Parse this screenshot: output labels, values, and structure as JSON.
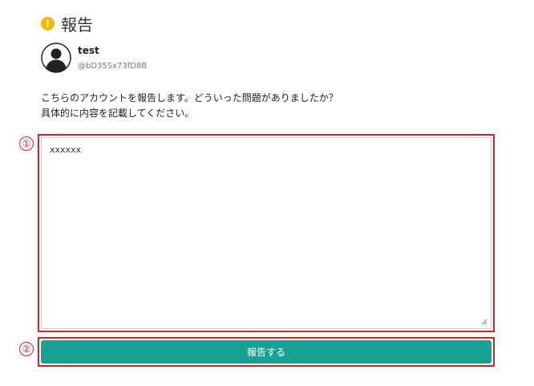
{
  "header": {
    "icon": "warning-icon",
    "icon_glyph": "!",
    "title": "報告"
  },
  "user": {
    "avatar_icon": "user-avatar-icon",
    "name": "test",
    "handle": "@bD35Sx73fD8B"
  },
  "description": {
    "line1": "こちらのアカウントを報告します。どういった問題がありましたか？",
    "line2": "具体的に内容を記載してください。"
  },
  "markers": {
    "one": "①",
    "two": "②"
  },
  "form": {
    "textarea_value": "xxxxxx",
    "submit_label": "報告する"
  },
  "colors": {
    "accent": "#18a294",
    "warning": "#f5b800",
    "highlight": "#d42020"
  }
}
